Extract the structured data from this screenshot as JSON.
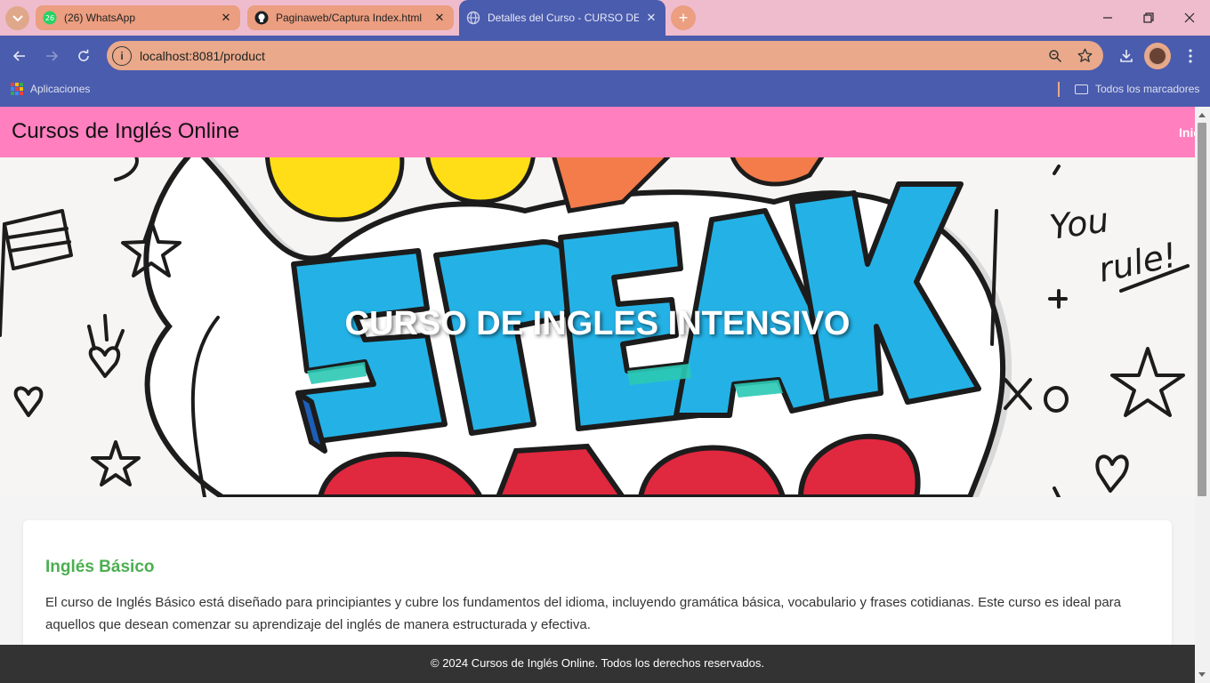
{
  "browser": {
    "tabs": [
      {
        "title": "(26) WhatsApp",
        "badge": "26",
        "favicon": "whatsapp-icon",
        "active": false
      },
      {
        "title": "Paginaweb/Captura Index.html",
        "favicon": "github-icon",
        "active": false
      },
      {
        "title": "Detalles del Curso - CURSO DE",
        "favicon": "globe-icon",
        "active": true
      }
    ],
    "url": "localhost:8081/product",
    "bookmarks": {
      "apps_label": "Aplicaciones",
      "all_label": "Todos los marcadores"
    },
    "colors": {
      "tabstrip": "#efbccd",
      "toolbar": "#4a5cad",
      "omnibox": "#e9a98a"
    }
  },
  "page": {
    "header": {
      "title": "Cursos de Inglés Online",
      "nav_item": "Inic"
    },
    "hero": {
      "title": "CURSO DE INGLES INTENSIVO",
      "art_text": [
        "SPEAK",
        "You",
        "rule!",
        "XO"
      ]
    },
    "course": {
      "name": "Inglés Básico",
      "description": "El curso de Inglés Básico está diseñado para principiantes y cubre los fundamentos del idioma, incluyendo gramática básica, vocabulario y frases cotidianas. Este curso es ideal para aquellos que desean comenzar su aprendizaje del inglés de manera estructurada y efectiva."
    },
    "footer": {
      "text": "© 2024 Cursos de Inglés Online. Todos los derechos reservados."
    },
    "colors": {
      "header": "#ff7fbf",
      "course_title": "#4caf50",
      "footer": "#333333"
    }
  }
}
